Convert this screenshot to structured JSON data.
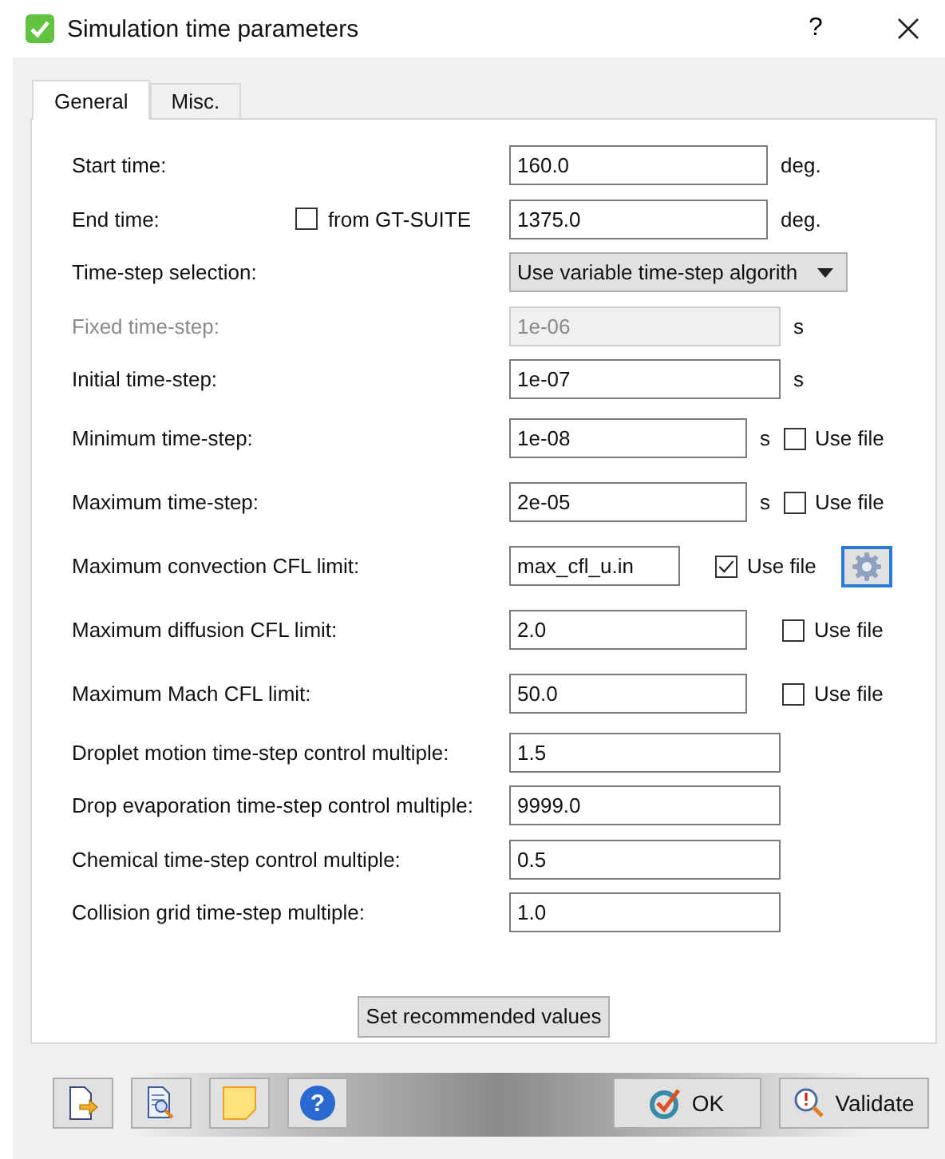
{
  "window": {
    "title": "Simulation time parameters",
    "help": "?"
  },
  "tabs": [
    {
      "label": "General",
      "selected": true
    },
    {
      "label": "Misc.",
      "selected": false
    }
  ],
  "rows": [
    {
      "kind": "field",
      "label": "Start time:",
      "value": "160.0",
      "unit": "deg.",
      "disabled": false
    },
    {
      "kind": "field",
      "label": "End time:",
      "option": {
        "label": "from GT-SUITE",
        "checked": false
      },
      "value": "1375.0",
      "unit": "deg.",
      "disabled": false
    },
    {
      "kind": "select",
      "label": "Time-step selection:",
      "value": "Use variable time-step algorith"
    },
    {
      "kind": "field",
      "label": "Fixed time-step:",
      "value": "1e-06",
      "unit": "s",
      "disabled": true
    },
    {
      "kind": "field",
      "label": "Initial time-step:",
      "value": "1e-07",
      "unit": "s",
      "disabled": false
    },
    {
      "kind": "file",
      "label": "Minimum time-step:",
      "value": "1e-08",
      "unit": "s",
      "use_file": {
        "label": "Use file",
        "checked": false
      }
    },
    {
      "kind": "file",
      "label": "Maximum time-step:",
      "value": "2e-05",
      "unit": "s",
      "use_file": {
        "label": "Use file",
        "checked": false
      }
    },
    {
      "kind": "file",
      "label": "Maximum convection CFL limit:",
      "value": "max_cfl_u.in",
      "use_file": {
        "label": "Use file",
        "checked": true
      },
      "settings": true
    },
    {
      "kind": "file",
      "label": "Maximum diffusion CFL limit:",
      "value": "2.0",
      "use_file": {
        "label": "Use file",
        "checked": false
      }
    },
    {
      "kind": "file",
      "label": "Maximum Mach CFL limit:",
      "value": "50.0",
      "use_file": {
        "label": "Use file",
        "checked": false
      }
    },
    {
      "kind": "field",
      "label": "Droplet motion time-step control multiple:",
      "value": "1.5",
      "disabled": false
    },
    {
      "kind": "field",
      "label": "Drop evaporation time-step control multiple:",
      "value": "9999.0",
      "disabled": false
    },
    {
      "kind": "field",
      "label": "Chemical time-step control multiple:",
      "value": "0.5",
      "disabled": false
    },
    {
      "kind": "field",
      "label": "Collision grid time-step multiple:",
      "value": "1.0",
      "disabled": false
    }
  ],
  "recommend_button": "Set recommended values",
  "footer": {
    "help_glyph": "?",
    "ok": "OK",
    "validate": "Validate"
  }
}
